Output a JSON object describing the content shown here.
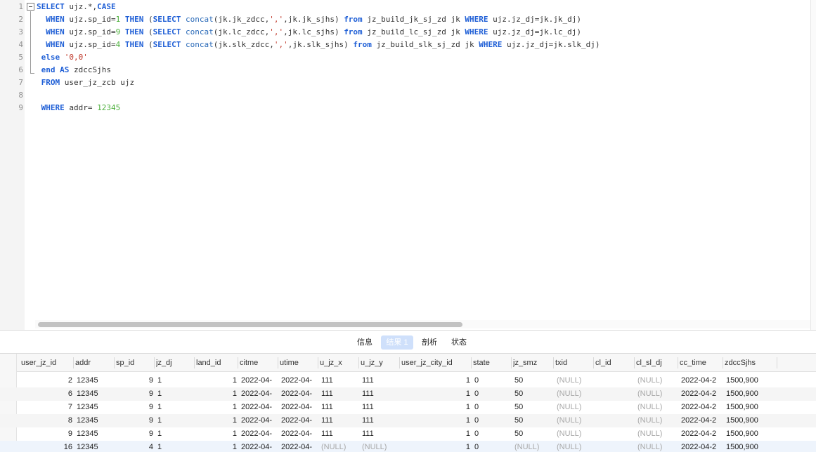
{
  "editor": {
    "line_numbers": [
      "1",
      "2",
      "3",
      "4",
      "5",
      "6",
      "7",
      "8",
      "9"
    ],
    "lines": [
      [
        [
          "k",
          "SELECT"
        ],
        [
          "t",
          " ujz.*,"
        ],
        [
          "k",
          "CASE"
        ]
      ],
      [
        [
          "t",
          "  "
        ],
        [
          "k",
          "WHEN"
        ],
        [
          "t",
          " ujz.sp_id="
        ],
        [
          "n",
          "1"
        ],
        [
          "t",
          " "
        ],
        [
          "k",
          "THEN"
        ],
        [
          "t",
          " ("
        ],
        [
          "k",
          "SELECT"
        ],
        [
          "t",
          " "
        ],
        [
          "f",
          "concat"
        ],
        [
          "t",
          "(jk.jk_zdcc,"
        ],
        [
          "s",
          "','"
        ],
        [
          "t",
          ",jk.jk_sjhs) "
        ],
        [
          "k",
          "from"
        ],
        [
          "t",
          " jz_build_jk_sj_zd jk "
        ],
        [
          "k",
          "WHERE"
        ],
        [
          "t",
          " ujz.jz_dj=jk.jk_dj)"
        ]
      ],
      [
        [
          "t",
          "  "
        ],
        [
          "k",
          "WHEN"
        ],
        [
          "t",
          " ujz.sp_id="
        ],
        [
          "n",
          "9"
        ],
        [
          "t",
          " "
        ],
        [
          "k",
          "THEN"
        ],
        [
          "t",
          " ("
        ],
        [
          "k",
          "SELECT"
        ],
        [
          "t",
          " "
        ],
        [
          "f",
          "concat"
        ],
        [
          "t",
          "(jk.lc_zdcc,"
        ],
        [
          "s",
          "','"
        ],
        [
          "t",
          ",jk.lc_sjhs) "
        ],
        [
          "k",
          "from"
        ],
        [
          "t",
          " jz_build_lc_sj_zd jk "
        ],
        [
          "k",
          "WHERE"
        ],
        [
          "t",
          " ujz.jz_dj=jk.lc_dj)"
        ]
      ],
      [
        [
          "t",
          "  "
        ],
        [
          "k",
          "WHEN"
        ],
        [
          "t",
          " ujz.sp_id="
        ],
        [
          "n",
          "4"
        ],
        [
          "t",
          " "
        ],
        [
          "k",
          "THEN"
        ],
        [
          "t",
          " ("
        ],
        [
          "k",
          "SELECT"
        ],
        [
          "t",
          " "
        ],
        [
          "f",
          "concat"
        ],
        [
          "t",
          "(jk.slk_zdcc,"
        ],
        [
          "s",
          "','"
        ],
        [
          "t",
          ",jk.slk_sjhs) "
        ],
        [
          "k",
          "from"
        ],
        [
          "t",
          " jz_build_slk_sj_zd jk "
        ],
        [
          "k",
          "WHERE"
        ],
        [
          "t",
          " ujz.jz_dj=jk.slk_dj)"
        ]
      ],
      [
        [
          "t",
          " "
        ],
        [
          "k",
          "else"
        ],
        [
          "t",
          " "
        ],
        [
          "s",
          "'0,0'"
        ]
      ],
      [
        [
          "t",
          " "
        ],
        [
          "k",
          "end AS"
        ],
        [
          "t",
          " zdccSjhs"
        ]
      ],
      [
        [
          "t",
          " "
        ],
        [
          "k",
          "FROM"
        ],
        [
          "t",
          " user_jz_zcb ujz"
        ]
      ],
      [],
      [
        [
          "t",
          " "
        ],
        [
          "k",
          "WHERE"
        ],
        [
          "t",
          " addr= "
        ],
        [
          "n",
          "12345"
        ]
      ]
    ]
  },
  "tabs": [
    "信息",
    "结果 1",
    "剖析",
    "状态"
  ],
  "active_tab": "结果 1",
  "grid": {
    "columns": [
      "user_jz_id",
      "addr",
      "sp_id",
      "jz_dj",
      "land_id",
      "citme",
      "utime",
      "u_jz_x",
      "u_jz_y",
      "user_jz_city_id",
      "state",
      "jz_smz",
      "txid",
      "cl_id",
      "cl_sl_dj",
      "cc_time",
      "zdccSjhs"
    ],
    "rows": [
      [
        "2",
        "12345",
        "9",
        "1",
        "1",
        "2022-04-",
        "2022-04-",
        "111",
        "111",
        "1",
        "0",
        "50",
        "(NULL)",
        "",
        "(NULL)",
        "2022-04-2",
        "1500,900"
      ],
      [
        "6",
        "12345",
        "9",
        "1",
        "1",
        "2022-04-",
        "2022-04-",
        "111",
        "111",
        "1",
        "0",
        "50",
        "(NULL)",
        "",
        "(NULL)",
        "2022-04-2",
        "1500,900"
      ],
      [
        "7",
        "12345",
        "9",
        "1",
        "1",
        "2022-04-",
        "2022-04-",
        "111",
        "111",
        "1",
        "0",
        "50",
        "(NULL)",
        "",
        "(NULL)",
        "2022-04-2",
        "1500,900"
      ],
      [
        "8",
        "12345",
        "9",
        "1",
        "1",
        "2022-04-",
        "2022-04-",
        "111",
        "111",
        "1",
        "0",
        "50",
        "(NULL)",
        "",
        "(NULL)",
        "2022-04-2",
        "1500,900"
      ],
      [
        "9",
        "12345",
        "9",
        "1",
        "1",
        "2022-04-",
        "2022-04-",
        "111",
        "111",
        "1",
        "0",
        "50",
        "(NULL)",
        "",
        "(NULL)",
        "2022-04-2",
        "1500,900"
      ],
      [
        "16",
        "12345",
        "4",
        "1",
        "1",
        "2022-04-",
        "2022-04-",
        "(NULL)",
        "(NULL)",
        "1",
        "0",
        "(NULL)",
        "(NULL)",
        "",
        "(NULL)",
        "2022-04-2",
        "1500,900"
      ]
    ]
  }
}
